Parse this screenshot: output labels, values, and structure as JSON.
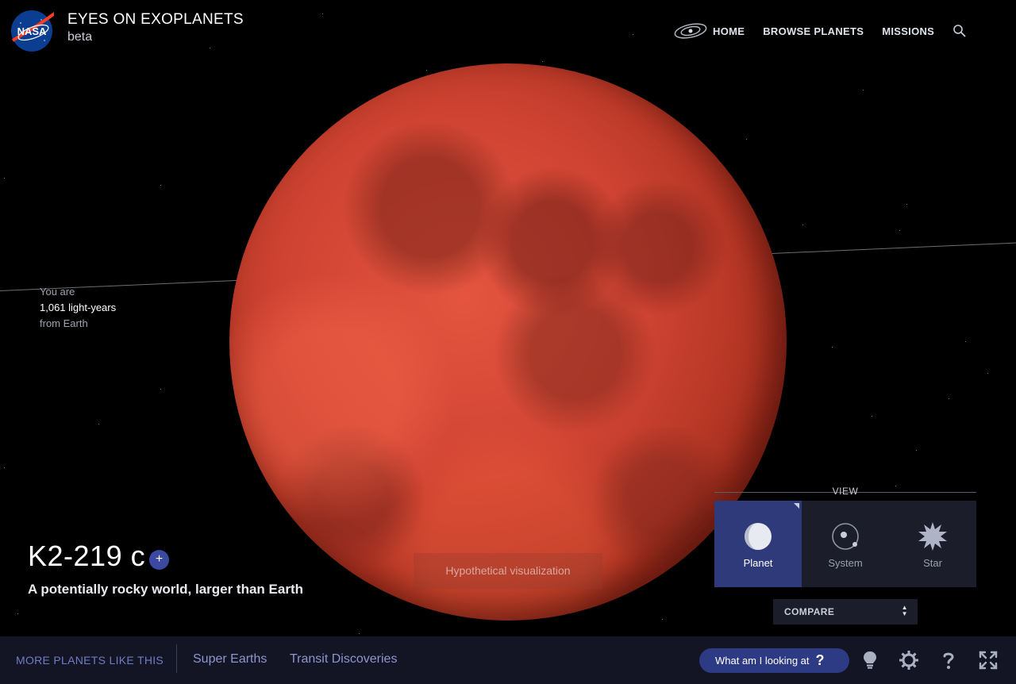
{
  "header": {
    "brand_title": "EYES ON EXOPLANETS",
    "brand_subtitle": "beta",
    "logo_text": "NASA",
    "nav": [
      {
        "label": "HOME"
      },
      {
        "label": "BROWSE PLANETS"
      },
      {
        "label": "MISSIONS"
      }
    ]
  },
  "distance": {
    "line1": "You are",
    "line2": "1,061 light-years",
    "line3": "from Earth"
  },
  "planet": {
    "name": "K2-219 c",
    "add_label": "+",
    "tagline": "A potentially rocky world, larger than Earth",
    "notice": "Hypothetical visualization"
  },
  "view": {
    "label": "VIEW",
    "options": [
      {
        "label": "Planet",
        "icon": "planet-icon",
        "active": true
      },
      {
        "label": "System",
        "icon": "system-icon",
        "active": false
      },
      {
        "label": "Star",
        "icon": "star-icon",
        "active": false
      }
    ],
    "compare_label": "COMPARE"
  },
  "bottom_bar": {
    "more_label": "MORE PLANETS LIKE THIS",
    "categories": [
      "Super Earths",
      "Transit Discoveries"
    ],
    "what_label": "What am I looking at",
    "what_mark": "?"
  },
  "colors": {
    "accent": "#2f3a7a",
    "planet": "#cf4332",
    "bottom_bar": "#131524",
    "link": "#8d96cc"
  }
}
